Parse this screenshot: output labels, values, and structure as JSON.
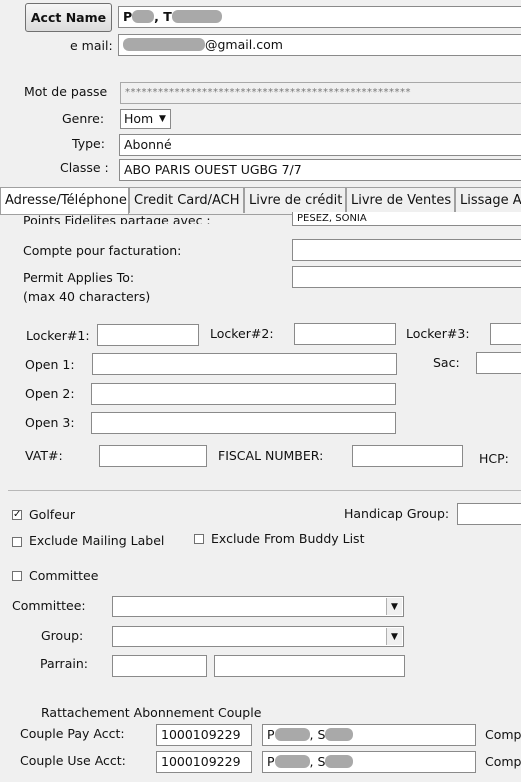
{
  "header": {
    "acct_name_button": "Acct Name",
    "acct_name_value_prefix": "P",
    "acct_name_value_mid": ", T",
    "email_label": "e mail:",
    "email_domain": "@gmail.com",
    "password_label": "Mot de passe",
    "password_mask": "****************************************************",
    "genre_label": "Genre:",
    "genre_value": "Hom",
    "type_label": "Type:",
    "type_value": "Abonné",
    "classe_label": "Classe :",
    "classe_value": "ABO PARIS OUEST UGBG 7/7"
  },
  "tabs": [
    {
      "label": "Adresse/Téléphone"
    },
    {
      "label": "Credit Card/ACH"
    },
    {
      "label": "Livre de crédit"
    },
    {
      "label": "Livre de Ventes"
    },
    {
      "label": "Lissage A"
    }
  ],
  "details": {
    "points_label": "Points Fidelites partage avec :",
    "points_value": "PESEZ, SONIA",
    "compte_label": "Compte pour facturation:",
    "permit_label": "Permit Applies To:",
    "permit_hint": "(max 40 characters)",
    "locker1_label": "Locker#1:",
    "locker2_label": "Locker#2:",
    "locker3_label": "Locker#3:",
    "open1_label": "Open 1:",
    "sac_label": "Sac:",
    "open2_label": "Open 2:",
    "open3_label": "Open 3:",
    "vat_label": "VAT#:",
    "fiscal_label": "FISCAL NUMBER:",
    "hcp_label": "HCP:"
  },
  "options": {
    "golfeur_label": "Golfeur",
    "golfeur_checked": true,
    "handicap_group_label": "Handicap Group:",
    "exclude_mailing_label": "Exclude Mailing Label",
    "exclude_buddy_label": "Exclude From Buddy List",
    "committee_check_label": "Committee",
    "committee_label": "Committee:",
    "group_label": "Group:",
    "parrain_label": "Parrain:"
  },
  "couple": {
    "section_title": "Rattachement Abonnement Couple",
    "pay_label": "Couple Pay Acct:",
    "pay_acct": "1000109229",
    "pay_name_prefix": "P",
    "pay_name_mid": ", S",
    "use_label": "Couple Use Acct:",
    "use_acct": "1000109229",
    "use_name_prefix": "P",
    "use_name_mid": ", S",
    "comp_label": "Comp"
  },
  "colors": {
    "background": "#f0f0f0",
    "field_border": "#8a8a8a",
    "redaction": "#a9a9a9"
  }
}
